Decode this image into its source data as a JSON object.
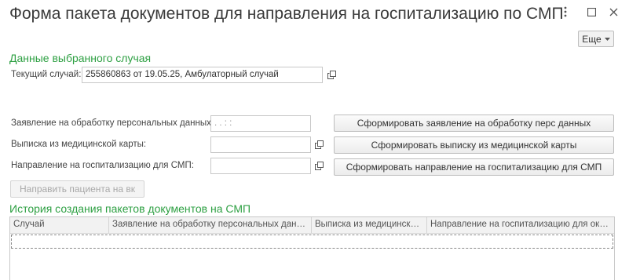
{
  "window": {
    "title": "Форма пакета документов для направления на госпитализацию по СМП",
    "menu_icon": "vertical-dots-icon",
    "maximize_icon": "maximize-icon",
    "close_icon": "close-icon"
  },
  "toolbar": {
    "more_label": "Еще",
    "more_icon": "dropdown-arrow-icon"
  },
  "selected_case": {
    "section_title": "Данные выбранного случая",
    "current_case_label": "Текущий случай:",
    "current_case_value": "255860863 от 19.05.25, Амбулаторный случай"
  },
  "documents": {
    "consent_label": "Заявление на обработку персональных данных:",
    "consent_value": " .  .      :  :",
    "medical_extract_label": "Выписка из медицинской карты:",
    "medical_extract_value": "",
    "referral_label": "Направление на госпитализацию для СМП:",
    "referral_value": "",
    "btn_consent": "Сформировать заявление на обработку перс данных",
    "btn_extract": "Сформировать выписку из медицинской карты",
    "btn_referral": "Сформировать направление на госпитализацию для СМП",
    "btn_send": "Направить пациента на вк"
  },
  "history": {
    "section_title": "История создания пакетов документов на СМП",
    "columns": [
      "Случай",
      "Заявление на обработку персональных данных",
      "Выписка из медицинской ...",
      "Направление на госпитализацию для оказ..."
    ],
    "rows": []
  },
  "colors": {
    "accent_green": "#2ea043"
  }
}
